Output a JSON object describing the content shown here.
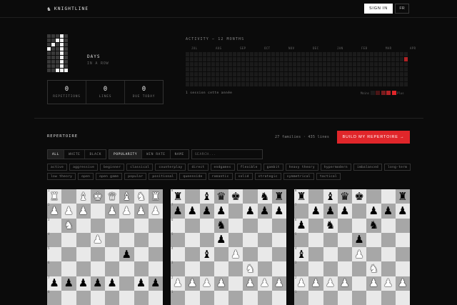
{
  "header": {
    "brand": "KNIGHTLINE",
    "sign_in": "SIGN IN",
    "lang": "FR"
  },
  "streak": {
    "value": "1",
    "days_label": "DAYS",
    "subtitle": "IN A ROW",
    "stats": [
      {
        "value": "0",
        "label": "REPETITIONS"
      },
      {
        "value": "0",
        "label": "LINES"
      },
      {
        "value": "0",
        "label": "DUE TODAY"
      }
    ]
  },
  "activity": {
    "title": "ACTIVITY — 12 MONTHS",
    "months": [
      "JUL",
      "AUG",
      "SEP",
      "OCT",
      "NOV",
      "DEC",
      "JAN",
      "FEB",
      "MAR",
      "APR"
    ],
    "footer": "1 session cette année",
    "legend_less": "Moins",
    "legend_more": "Plus",
    "colors": [
      "#1b1b1b",
      "#4a1516",
      "#7a1c1e",
      "#b02225",
      "#e0262a"
    ],
    "active_week": 51,
    "active_day": 1
  },
  "repertoire": {
    "title": "REPERTOIRE",
    "subtitle": "",
    "meta": "27 families · 435 lines",
    "build_button": "BUILD MY REPERTOIRE →",
    "color_filters": [
      "ALL",
      "WHITE",
      "BLACK"
    ],
    "active_color": "ALL",
    "sort_filters": [
      "POPULARITY",
      "WIN RATE",
      "NAME"
    ],
    "active_sort": "POPULARITY",
    "search_placeholder": "SEARCH...",
    "tags": [
      "active",
      "aggressive",
      "beginner",
      "classical",
      "counterplay",
      "direct",
      "endgames",
      "flexible",
      "gambit",
      "heavy theory",
      "hypermodern",
      "imbalanced",
      "long-term",
      "low theory",
      "open",
      "open game",
      "popular",
      "positional",
      "queenside",
      "romantic",
      "solid",
      "strategic",
      "symmetrical",
      "tactical"
    ]
  },
  "boards": [
    {
      "position": [
        "♜",
        "·",
        "♝",
        "♚",
        "♛",
        "♝",
        "♞",
        "♜",
        "♟",
        "♟",
        "♟",
        "·",
        "♟",
        "♟",
        "♟",
        "♟",
        "·",
        "♞",
        "·",
        "·",
        "·",
        "·",
        "·",
        "·",
        "·",
        "·",
        "·",
        "♟",
        "·",
        "·",
        "·",
        "·",
        "·",
        "·",
        "·",
        "·",
        "·",
        "♙",
        "·",
        "·",
        "·",
        "·",
        "·",
        "·",
        "·",
        "·",
        "·",
        "·",
        "♙",
        "♙",
        "♙",
        "♙",
        "♙",
        "·",
        "♙",
        "♙",
        "·",
        "·",
        "·",
        "·",
        "·",
        "·",
        "·",
        "·"
      ],
      "white_on_top": true
    },
    {
      "position": [
        "♜",
        "·",
        "♝",
        "♛",
        "♚",
        "·",
        "♞",
        "♜",
        "♟",
        "♟",
        "♟",
        "♟",
        "·",
        "♟",
        "♟",
        "♟",
        "·",
        "·",
        "·",
        "♞",
        "·",
        "·",
        "·",
        "·",
        "·",
        "·",
        "·",
        "♟",
        "·",
        "·",
        "·",
        "·",
        "·",
        "·",
        "♝",
        "·",
        "♙",
        "·",
        "·",
        "·",
        "·",
        "·",
        "·",
        "·",
        "·",
        "♘",
        "·",
        "·",
        "♙",
        "♙",
        "♙",
        "♙",
        "·",
        "♙",
        "♙",
        "♙",
        "·",
        "·",
        "·",
        "·",
        "·",
        "·",
        "·",
        "·"
      ],
      "white_on_top": false
    },
    {
      "position": [
        "♜",
        "·",
        "♝",
        "♛",
        "♚",
        "·",
        "·",
        "♜",
        "·",
        "♟",
        "♟",
        "♟",
        "·",
        "♟",
        "♟",
        "♟",
        "♟",
        "·",
        "♞",
        "·",
        "·",
        "♞",
        "·",
        "·",
        "·",
        "·",
        "·",
        "·",
        "♟",
        "·",
        "·",
        "·",
        "♝",
        "·",
        "·",
        "·",
        "♙",
        "·",
        "·",
        "·",
        "·",
        "·",
        "·",
        "·",
        "·",
        "♘",
        "·",
        "·",
        "♙",
        "♙",
        "♙",
        "♙",
        "·",
        "♙",
        "♙",
        "♙",
        "·",
        "·",
        "·",
        "·",
        "·",
        "·",
        "·",
        "·"
      ],
      "white_on_top": false
    }
  ]
}
